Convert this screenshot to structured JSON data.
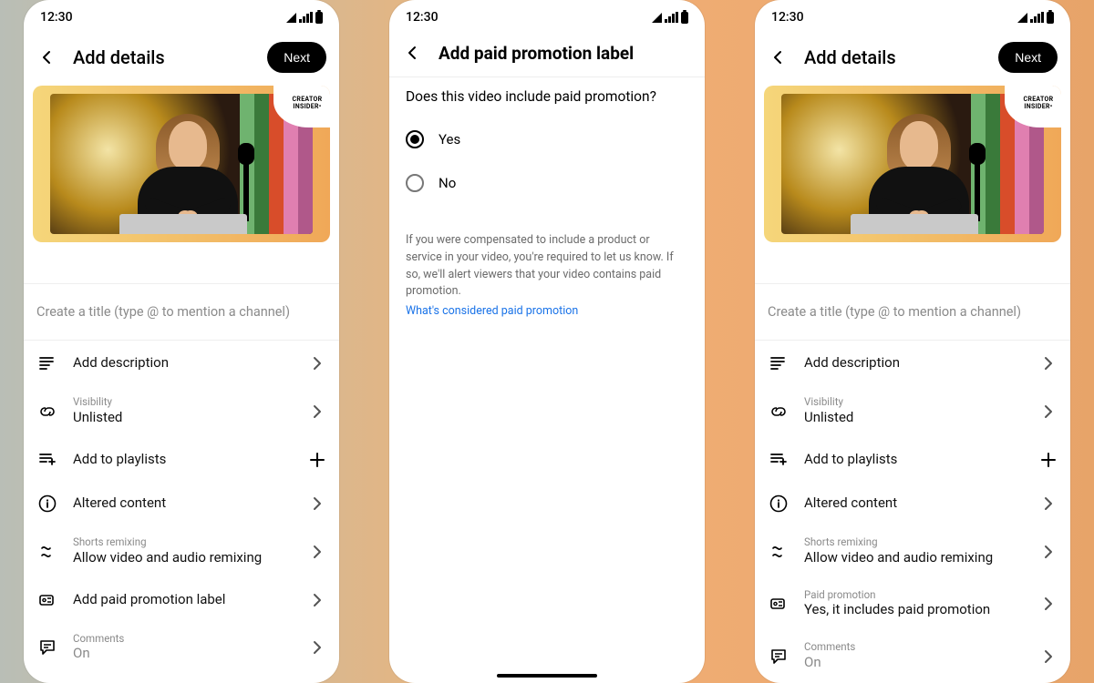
{
  "status": {
    "time": "12:30"
  },
  "badge": {
    "l1": "CREATOR",
    "l2": "INSIDER•"
  },
  "screenA": {
    "title": "Add details",
    "next": "Next",
    "title_placeholder": "Create a title (type @ to mention a channel)",
    "rows": {
      "description": "Add description",
      "visibility_sub": "Visibility",
      "visibility_val": "Unlisted",
      "playlists": "Add to playlists",
      "altered": "Altered content",
      "remix_sub": "Shorts remixing",
      "remix_val": "Allow video and audio remixing",
      "paid": "Add paid promotion label",
      "comments_sub": "Comments",
      "comments_val": "On"
    }
  },
  "screenB": {
    "title": "Add paid promotion label",
    "question": "Does this video include paid promotion?",
    "yes": "Yes",
    "no": "No",
    "note": "If you were compensated to include a product or service in your video, you're required to let us know. If so, we'll alert viewers that your video contains paid promotion.",
    "link": "What's considered paid promotion"
  },
  "screenC": {
    "paid_sub": "Paid promotion",
    "paid_val": "Yes, it includes paid promotion"
  }
}
